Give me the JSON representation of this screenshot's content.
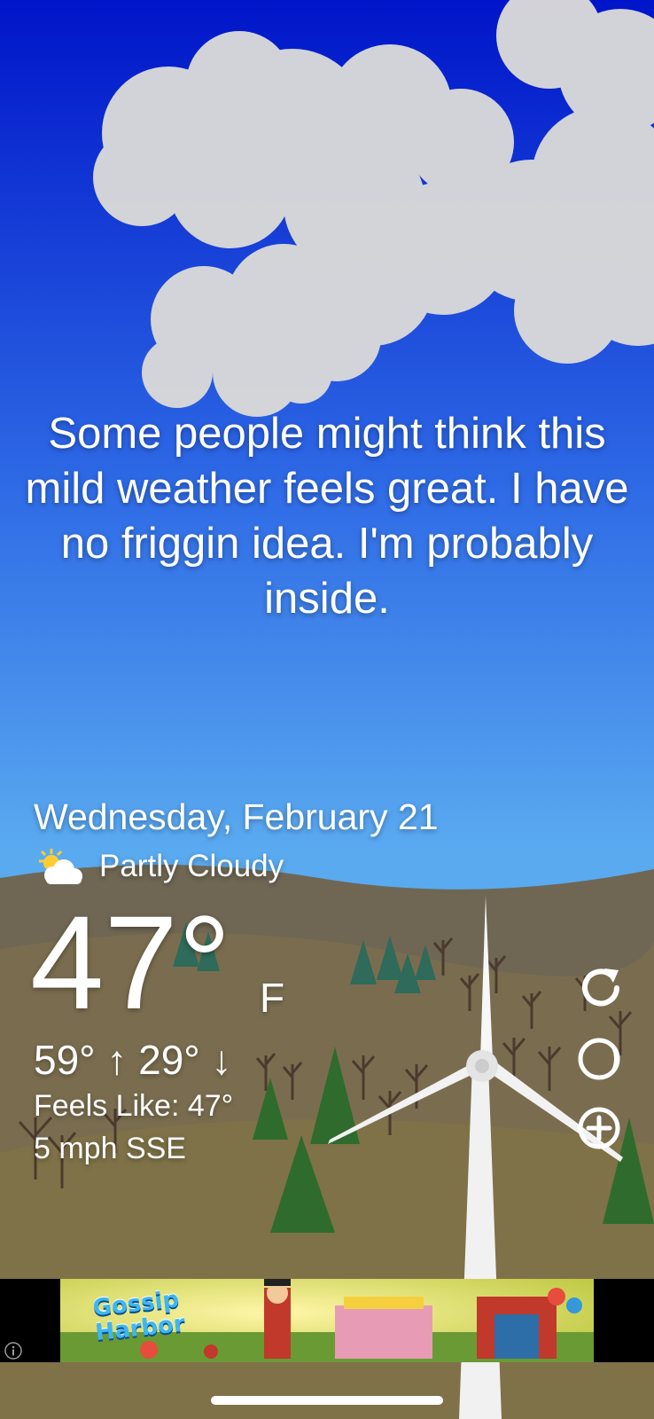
{
  "colors": {
    "sky_top": "#0015c9",
    "sky_bottom": "#5aaaf0",
    "ground": "#7d6f4b",
    "hills": "#6e6650",
    "tree_green": "#2f6b2c",
    "text": "#ffffff"
  },
  "snark_text": "Some people might think this mild weather feels great. I have no friggin idea. I'm probably inside.",
  "weather": {
    "date": "Wednesday, February 21",
    "condition_icon": "partly-cloudy-icon",
    "condition": "Partly Cloudy",
    "temperature": "47°",
    "unit": "F",
    "hi_lo": "59° ↑ 29° ↓",
    "feels_like": "Feels Like: 47°",
    "wind": "5 mph SSE"
  },
  "controls": [
    {
      "icon": "refresh-icon"
    },
    {
      "icon": "moon-icon"
    },
    {
      "icon": "add-location-icon"
    }
  ],
  "ad": {
    "title_line1": "Gossip",
    "title_line2": "Harbor",
    "info_icon": "info-icon"
  }
}
